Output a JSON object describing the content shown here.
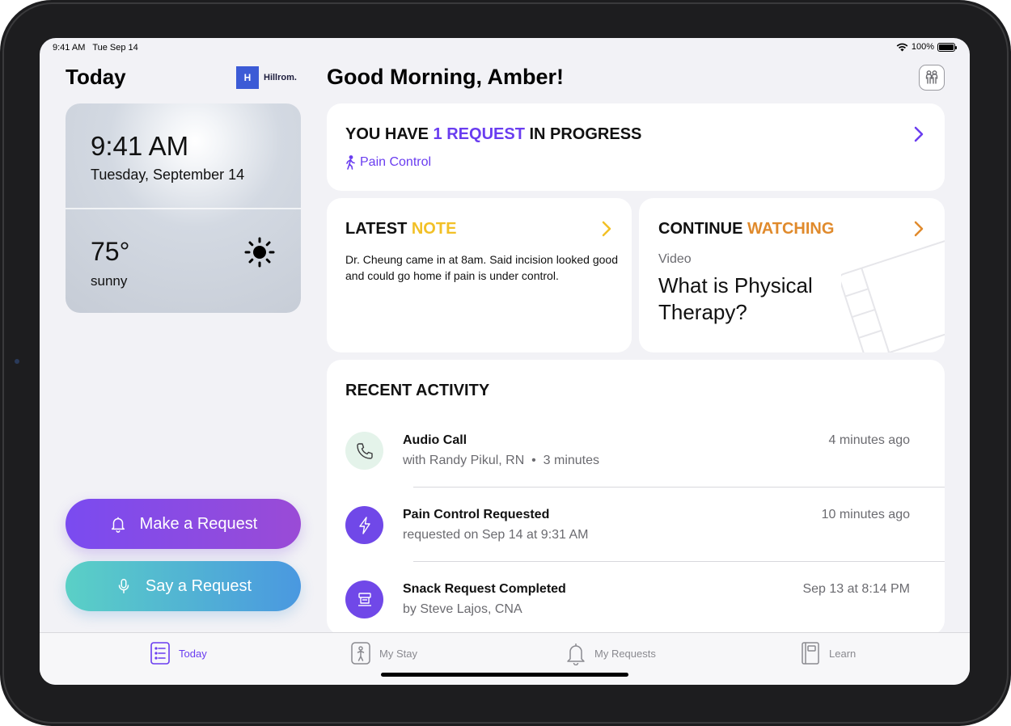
{
  "status_bar": {
    "time_date": "9:41 AM   Tue Sep 14",
    "battery": "100%"
  },
  "sidebar": {
    "title": "Today",
    "brand": {
      "mark": "H",
      "name": "Hillrom."
    },
    "weather": {
      "time": "9:41 AM",
      "date": "Tuesday, September 14",
      "temperature": "75°",
      "condition": "sunny",
      "icon": "sun-icon"
    },
    "make_request": {
      "label": "Make a Request",
      "icon": "bell-icon"
    },
    "say_request": {
      "label": "Say a Request",
      "icon": "microphone-icon"
    }
  },
  "main": {
    "greeting": "Good Morning, Amber!",
    "request_card": {
      "title_prefix": "YOU HAVE ",
      "title_highlight": "1 REQUEST",
      "title_suffix": " IN PROGRESS",
      "item": "Pain Control",
      "highlight_color": "#6a3df0"
    },
    "note_card": {
      "title_prefix": "LATEST ",
      "title_highlight": "NOTE",
      "body": "Dr. Cheung came in at 8am. Said incision looked good and could go home if pain is under control.",
      "highlight_color": "#f2c026"
    },
    "watch_card": {
      "title_prefix": "CONTINUE ",
      "title_highlight": "WATCHING",
      "kicker": "Video",
      "video_title": "What is Physical Therapy?",
      "highlight_color": "#e08a2c"
    },
    "activity": {
      "title": "RECENT ACTIVITY",
      "items": [
        {
          "title": "Audio Call",
          "subtitle": "with Randy Pikul, RN  •  3 minutes",
          "time": "4 minutes ago",
          "icon": "phone-icon"
        },
        {
          "title": "Pain Control Requested",
          "subtitle": "requested on Sep 14 at 9:31 AM",
          "time": "10 minutes ago",
          "icon": "lightning-icon"
        },
        {
          "title": "Snack Request Completed",
          "subtitle": "by Steve Lajos, CNA",
          "time": "Sep 13 at 8:14 PM",
          "icon": "food-tray-icon"
        }
      ]
    }
  },
  "tabs": [
    {
      "label": "Today",
      "icon": "list-icon",
      "active": true
    },
    {
      "label": "My Stay",
      "icon": "person-card-icon",
      "active": false
    },
    {
      "label": "My Requests",
      "icon": "bell-icon",
      "active": false
    },
    {
      "label": "Learn",
      "icon": "book-icon",
      "active": false
    }
  ]
}
